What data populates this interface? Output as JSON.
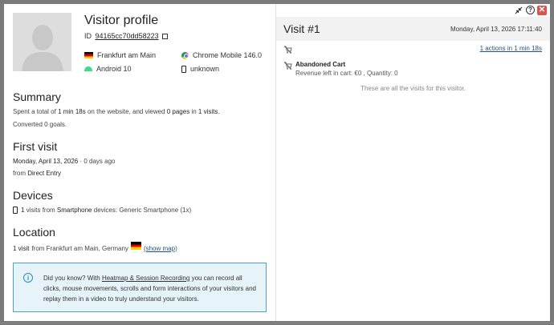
{
  "window_controls": {
    "minimize_icon": "collapse-icon",
    "help_label": "?",
    "close_label": "✕"
  },
  "profile": {
    "title": "Visitor profile",
    "id_label": "ID",
    "id_value": "94165cc70dd58223",
    "location": "Frankfurt am Main",
    "browser": "Chrome Mobile 146.0",
    "os": "Android 10",
    "device": "unknown"
  },
  "summary": {
    "heading": "Summary",
    "line1_a": "Spent a total of",
    "line1_time": "1 min 18s",
    "line1_b": "on the website, and viewed",
    "line1_pages": "0 pages",
    "line1_c": "in",
    "line1_visits": "1 visits",
    "line1_end": ".",
    "line2": "Converted 0 goals."
  },
  "first_visit": {
    "heading": "First visit",
    "date": "Monday, April 13, 2026",
    "ago": " · 0 days ago",
    "from_label": "from",
    "source": "Direct Entry"
  },
  "devices": {
    "heading": "Devices",
    "count": "1",
    "text_a": "visits from",
    "type": "Smartphone",
    "text_b": "devices: Generic Smartphone (1x)"
  },
  "location": {
    "heading": "Location",
    "visits": "1 visit",
    "text": "from Frankfurt am Main, Germany",
    "show_map": "(show map)"
  },
  "info": {
    "icon": "i",
    "text_a": "Did you know? With",
    "link": "Heatmap & Session Recording",
    "text_b": "you can record all clicks, mouse movements, scrolls and form interactions of your visitors and replay them in a video to truly understand your visitors."
  },
  "visit": {
    "title": "Visit #1",
    "date": "Monday, April 13, 2026 17:11:40",
    "actions_link": "1 actions in 1 min 18s",
    "action_title": "Abandoned Cart",
    "action_sub": "Revenue left in cart: €0 , Quantity: 0",
    "all_visits": "These are all the visits for this visitor."
  },
  "colors": {
    "info_border": "#4aa3c7",
    "info_bg": "#e6f3f9",
    "close_red": "#d9534f",
    "link_blue": "#23527c"
  }
}
